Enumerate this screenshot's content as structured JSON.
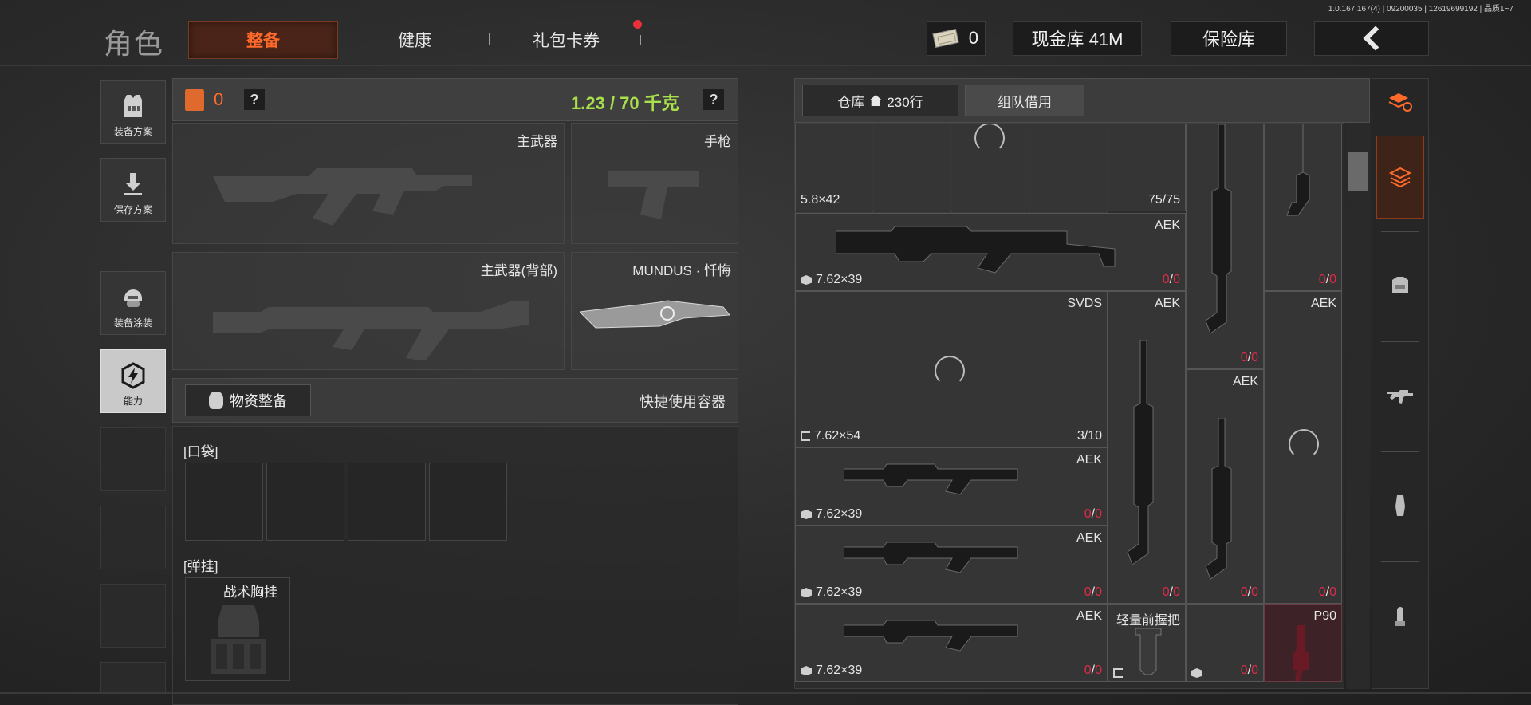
{
  "version": "1.0.167.167(4) | 09200035 | 12619699192 | 品质1~7",
  "header": {
    "title": "角色",
    "tabs": [
      {
        "label": "整备",
        "active": true
      },
      {
        "label": "健康",
        "active": false
      },
      {
        "label": "礼包卡券",
        "active": false,
        "notification": true
      }
    ],
    "cash_count": "0",
    "vault_label": "现金库 41M",
    "safe_label": "保险库",
    "back_icon": "chevron-left-icon"
  },
  "sidebar": {
    "items": [
      {
        "label": "装备方案",
        "icon": "vest-icon"
      },
      {
        "label": "保存方案",
        "icon": "download-icon"
      },
      {
        "label": "装备涂装",
        "icon": "helmet-icon"
      },
      {
        "label": "能力",
        "icon": "lightning-shield-icon",
        "active": true
      }
    ]
  },
  "loadout": {
    "armor_value": "0",
    "weight": "1.23 / 70 千克",
    "help": "?",
    "slots": {
      "primary": "主武器",
      "pistol": "手枪",
      "primary_back": "主武器(背部)",
      "melee": "MUNDUS · 忏悔"
    },
    "supply_button": "物资整备",
    "quick_container": "快捷使用容器",
    "pocket_label": "[口袋]",
    "rig_section_label": "[弹挂]",
    "rig_item": "战术胸挂"
  },
  "warehouse": {
    "tab_label": "仓库",
    "tab_count": "230行",
    "team_tab": "组队借用",
    "items": [
      {
        "id": "ammo1",
        "caliber": "5.8×42",
        "mag": "75/75"
      },
      {
        "id": "aek1",
        "name": "AEK",
        "caliber": "7.62×39",
        "ammo_cur": "0",
        "ammo_max": "0"
      },
      {
        "id": "svds",
        "name": "SVDS",
        "caliber": "7.62×54",
        "mag": "3/10"
      },
      {
        "id": "aek2",
        "name": "AEK",
        "caliber": "7.62×39",
        "ammo_cur": "0",
        "ammo_max": "0"
      },
      {
        "id": "aek3",
        "name": "AEK",
        "caliber": "7.62×39",
        "ammo_cur": "0",
        "ammo_max": "0"
      },
      {
        "id": "aek4",
        "name": "AEK",
        "caliber": "7.62×39",
        "ammo_cur": "0",
        "ammo_max": "0"
      },
      {
        "id": "vert_aek_a",
        "name": "AEK",
        "ammo_cur": "0",
        "ammo_max": "0"
      },
      {
        "id": "vert_aek_b",
        "name": "AEK",
        "ammo_cur": "0",
        "ammo_max": "0"
      },
      {
        "id": "vert_aek_c",
        "name": "AEK",
        "ammo_cur": "0",
        "ammo_max": "0"
      },
      {
        "id": "vert_aek_d",
        "name": "AEK",
        "ammo_cur": "0",
        "ammo_max": "0"
      },
      {
        "id": "vert_aek_e",
        "name": "AEK",
        "ammo_cur": "0",
        "ammo_max": "0"
      },
      {
        "id": "grip",
        "name": "轻量前握把"
      },
      {
        "id": "p90",
        "name": "P90",
        "ammo_cur": "0",
        "ammo_max": "0"
      }
    ]
  },
  "filters": [
    {
      "icon": "stack-refresh-icon"
    },
    {
      "icon": "layers-icon",
      "active": true
    },
    {
      "icon": "armor-icon"
    },
    {
      "icon": "rifle-icon"
    },
    {
      "icon": "magazine-icon"
    },
    {
      "icon": "bullet-icon"
    }
  ],
  "colors": {
    "accent": "#ff6a2a",
    "weight": "#a8e04c",
    "ammo_empty": "#e02a48"
  }
}
